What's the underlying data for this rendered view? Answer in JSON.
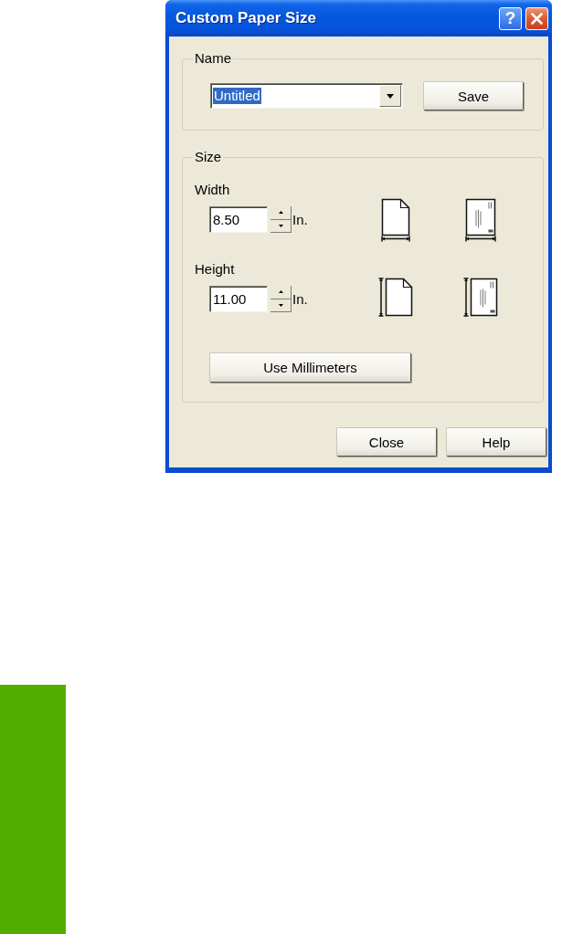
{
  "window": {
    "title": "Custom Paper Size",
    "title_buttons": [
      {
        "kind": "help",
        "glyph": "?"
      },
      {
        "kind": "close"
      }
    ]
  },
  "name_group": {
    "legend": "Name",
    "combo": {
      "value": "Untitled",
      "text_selected": true
    },
    "button": "Save"
  },
  "size_group": {
    "legend": "Size",
    "fields": [
      {
        "kind": "width",
        "label": "Width",
        "value": "8.50",
        "unit": "In."
      },
      {
        "kind": "height",
        "label": "Height",
        "value": "11.00",
        "unit": "In."
      }
    ],
    "button": "Use Millimeters"
  },
  "footer_buttons": [
    "Close",
    "Help"
  ]
}
